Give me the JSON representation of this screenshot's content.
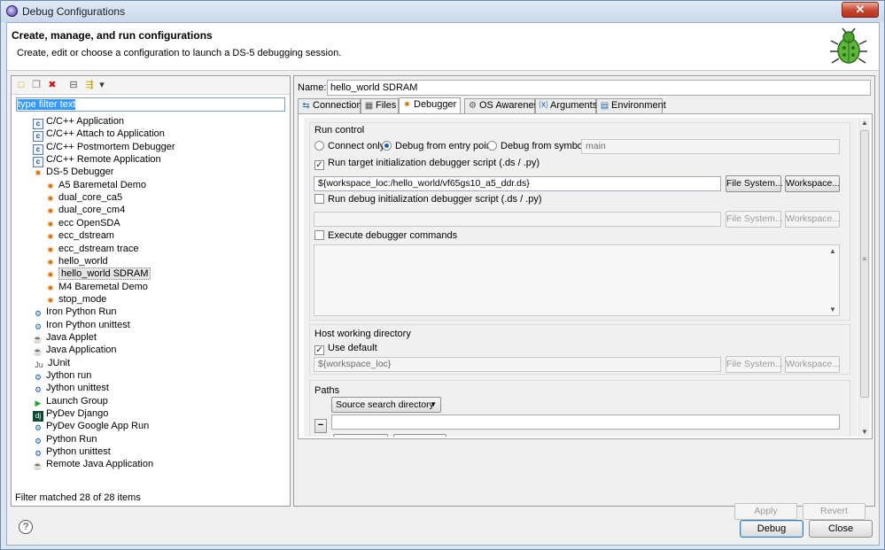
{
  "window": {
    "title": "Debug Configurations",
    "close_glyph": "✕"
  },
  "banner": {
    "heading": "Create, manage, and run configurations",
    "subtitle": "Create, edit or choose a configuration to launch a DS-5 debugging session."
  },
  "left": {
    "toolbar": [
      {
        "icon": "new-config-icon",
        "glyph": "□"
      },
      {
        "icon": "duplicate-icon",
        "glyph": "❐"
      },
      {
        "icon": "delete-icon",
        "glyph": "✖"
      },
      {
        "icon": "collapse-all-icon",
        "glyph": "⊟"
      },
      {
        "icon": "filter-icon",
        "glyph": "⇶"
      },
      {
        "icon": "dropdown-icon",
        "glyph": "▾"
      }
    ],
    "filter_text": "type filter text",
    "tree": [
      {
        "label": "C/C++ Application",
        "icon": "c",
        "glyph": "c",
        "level": 1
      },
      {
        "label": "C/C++ Attach to Application",
        "icon": "c",
        "glyph": "c",
        "level": 1
      },
      {
        "label": "C/C++ Postmortem Debugger",
        "icon": "c",
        "glyph": "c",
        "level": 1
      },
      {
        "label": "C/C++ Remote Application",
        "icon": "c",
        "glyph": "c",
        "level": 1
      },
      {
        "label": "DS-5 Debugger",
        "icon": "bugi",
        "glyph": "✷",
        "level": 1
      },
      {
        "label": "A5 Baremetal Demo",
        "icon": "bugi",
        "glyph": "✷",
        "level": 2
      },
      {
        "label": "dual_core_ca5",
        "icon": "bugi",
        "glyph": "✷",
        "level": 2
      },
      {
        "label": "dual_core_cm4",
        "icon": "bugi",
        "glyph": "✷",
        "level": 2
      },
      {
        "label": "ecc OpenSDA",
        "icon": "bugi",
        "glyph": "✷",
        "level": 2
      },
      {
        "label": "ecc_dstream",
        "icon": "bugi",
        "glyph": "✷",
        "level": 2
      },
      {
        "label": "ecc_dstream trace",
        "icon": "bugi",
        "glyph": "✷",
        "level": 2
      },
      {
        "label": "hello_world",
        "icon": "bugi",
        "glyph": "✷",
        "level": 2
      },
      {
        "label": "hello_world SDRAM",
        "icon": "bugi",
        "glyph": "✷",
        "level": 2,
        "selected": true
      },
      {
        "label": "M4 Baremetal Demo",
        "icon": "bugi",
        "glyph": "✷",
        "level": 2
      },
      {
        "label": "stop_mode",
        "icon": "bugi",
        "glyph": "✷",
        "level": 2
      },
      {
        "label": "Iron Python Run",
        "icon": "py",
        "glyph": "⚙",
        "level": 1
      },
      {
        "label": "Iron Python unittest",
        "icon": "py",
        "glyph": "⚙",
        "level": 1
      },
      {
        "label": "Java Applet",
        "icon": "java",
        "glyph": "☕",
        "level": 1
      },
      {
        "label": "Java Application",
        "icon": "java",
        "glyph": "☕",
        "level": 1
      },
      {
        "label": "JUnit",
        "icon": "ju",
        "glyph": "Ju",
        "level": 1
      },
      {
        "label": "Jython run",
        "icon": "py",
        "glyph": "⚙",
        "level": 1
      },
      {
        "label": "Jython unittest",
        "icon": "py",
        "glyph": "⚙",
        "level": 1
      },
      {
        "label": "Launch Group",
        "icon": "launch",
        "glyph": "▶",
        "level": 1
      },
      {
        "label": "PyDev Django",
        "icon": "dj",
        "glyph": "dj",
        "level": 1
      },
      {
        "label": "PyDev Google App Run",
        "icon": "py",
        "glyph": "⚙",
        "level": 1
      },
      {
        "label": "Python Run",
        "icon": "py",
        "glyph": "⚙",
        "level": 1
      },
      {
        "label": "Python unittest",
        "icon": "py",
        "glyph": "⚙",
        "level": 1
      },
      {
        "label": "Remote Java Application",
        "icon": "java",
        "glyph": "☕",
        "level": 1
      }
    ],
    "status": "Filter matched 28 of 28 items"
  },
  "right": {
    "name_label": "Name:",
    "name_value": "hello_world SDRAM",
    "tabs": [
      {
        "label": "Connection",
        "icon": "connection-icon",
        "glyph": "⇆"
      },
      {
        "label": "Files",
        "icon": "files-icon",
        "glyph": "▦"
      },
      {
        "label": "Debugger",
        "icon": "debugger-icon",
        "glyph": "✷",
        "active": true
      },
      {
        "label": "OS Awareness",
        "icon": "os-awareness-icon",
        "glyph": "⚙"
      },
      {
        "label": "Arguments",
        "icon": "arguments-icon",
        "glyph": "⒳"
      },
      {
        "label": "Environment",
        "icon": "environment-icon",
        "glyph": "▤"
      }
    ],
    "run_control": {
      "title": "Run control",
      "connect_only": "Connect only",
      "entry_point": "Debug from entry point",
      "from_symbol": "Debug from symbol",
      "symbol_value": "main",
      "run_target_script": "Run target initialization debugger script (.ds / .py)",
      "target_script_value": "${workspace_loc:/hello_world/vf65gs10_a5_ddr.ds}",
      "run_debug_script": "Run debug initialization debugger script (.ds / .py)",
      "debug_script_value": "",
      "execute_commands": "Execute debugger commands"
    },
    "host_dir": {
      "title": "Host working directory",
      "use_default": "Use default",
      "value": "${workspace_loc}"
    },
    "paths": {
      "title": "Paths",
      "combo_value": "Source search directory",
      "minus": "−"
    },
    "file_system_label": "File System...",
    "workspace_label": "Workspace...",
    "apply": "Apply",
    "revert": "Revert"
  },
  "footer": {
    "help_glyph": "?",
    "debug": "Debug",
    "close": "Close"
  }
}
